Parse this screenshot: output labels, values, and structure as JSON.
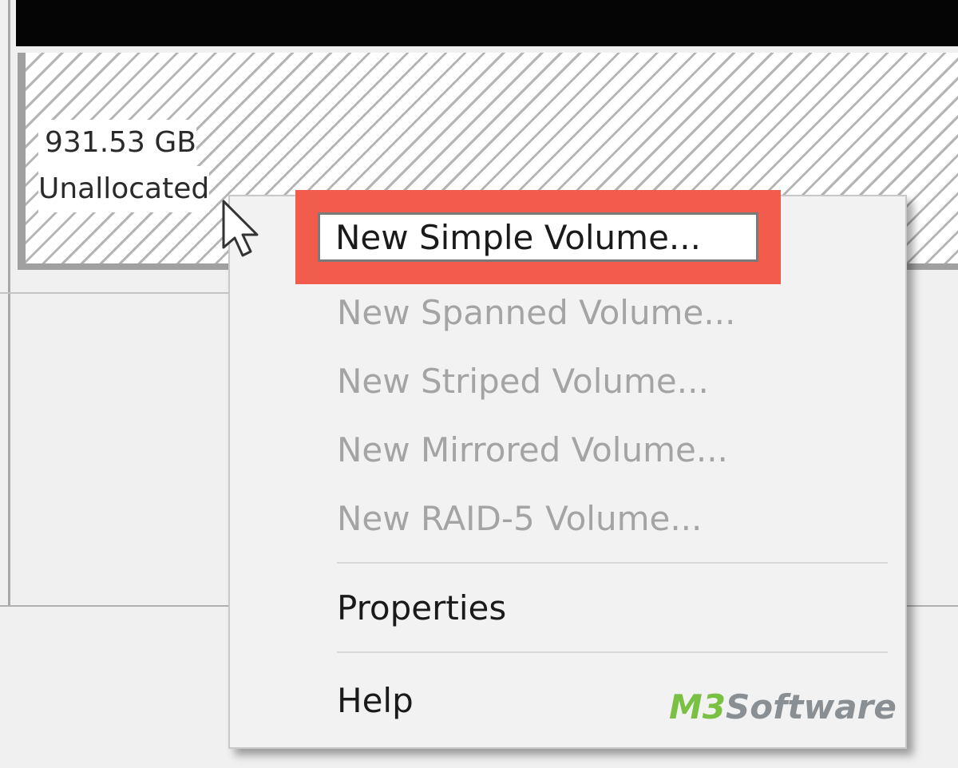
{
  "disk": {
    "partition_size": "931.53 GB",
    "partition_status": "Unallocated"
  },
  "context_menu": {
    "highlighted_item": "New Simple Volume...",
    "items": [
      {
        "label": "New Spanned Volume...",
        "enabled": false
      },
      {
        "label": "New Striped Volume...",
        "enabled": false
      },
      {
        "label": "New Mirrored Volume...",
        "enabled": false
      },
      {
        "label": "New RAID-5 Volume...",
        "enabled": false
      },
      {
        "label": "Properties",
        "enabled": true
      },
      {
        "label": "Help",
        "enabled": true
      }
    ]
  },
  "watermark": {
    "brand_prefix": "M3",
    "brand_suffix": "Software"
  },
  "colors": {
    "highlight_border": "#f25c4c",
    "brand_green": "#7ac143",
    "brand_gray": "#8a8f94",
    "disabled_text": "#a4a4a4"
  },
  "icons": {
    "cursor": "arrow-pointer-icon"
  }
}
